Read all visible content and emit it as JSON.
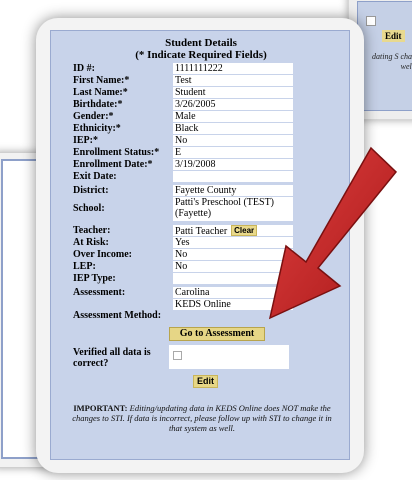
{
  "background_top_right": {
    "edit_label": "Edit",
    "note_fragment": "dating S chan well."
  },
  "form": {
    "title": "Student Details",
    "subtitle": "(* Indicate Required Fields)",
    "fields": [
      {
        "label": "ID #:",
        "value": "1111111222"
      },
      {
        "label": "First Name:*",
        "value": "Test"
      },
      {
        "label": "Last Name:*",
        "value": "Student"
      },
      {
        "label": "Birthdate:*",
        "value": "3/26/2005"
      },
      {
        "label": "Gender:*",
        "value": "Male"
      },
      {
        "label": "Ethnicity:*",
        "value": "Black"
      },
      {
        "label": "IEP:*",
        "value": "No"
      },
      {
        "label": "Enrollment Status:*",
        "value": "E"
      },
      {
        "label": "Enrollment Date:*",
        "value": "3/19/2008"
      },
      {
        "label": "Exit Date:",
        "value": ""
      },
      {
        "label": "District:",
        "value": "Fayette County"
      },
      {
        "label": "School:",
        "value": "Patti's Preschool (TEST) (Fayette)"
      },
      {
        "label": "Teacher:",
        "value": "Patti Teacher",
        "action": "Clear"
      },
      {
        "label": "At Risk:",
        "value": "Yes"
      },
      {
        "label": "Over Income:",
        "value": "No"
      },
      {
        "label": "LEP:",
        "value": "No"
      },
      {
        "label": "IEP Type:",
        "value": ""
      },
      {
        "label": "Assessment:",
        "value": "Carolina"
      },
      {
        "label": "Assessment Method:",
        "value": "KEDS Online"
      }
    ],
    "goto_assessment_label": "Go to Assessment",
    "verified_label": "Verified all data is correct?",
    "edit_label": "Edit",
    "important_heading": "IMPORTANT:",
    "important_text": "Editing/updating data in KEDS Online does NOT make the changes to STI. If data is incorrect, please follow up with STI to change it in that system as well."
  },
  "colors": {
    "panel": "#c8d3ea",
    "button": "#e6d686",
    "arrow": "#cc2222"
  }
}
